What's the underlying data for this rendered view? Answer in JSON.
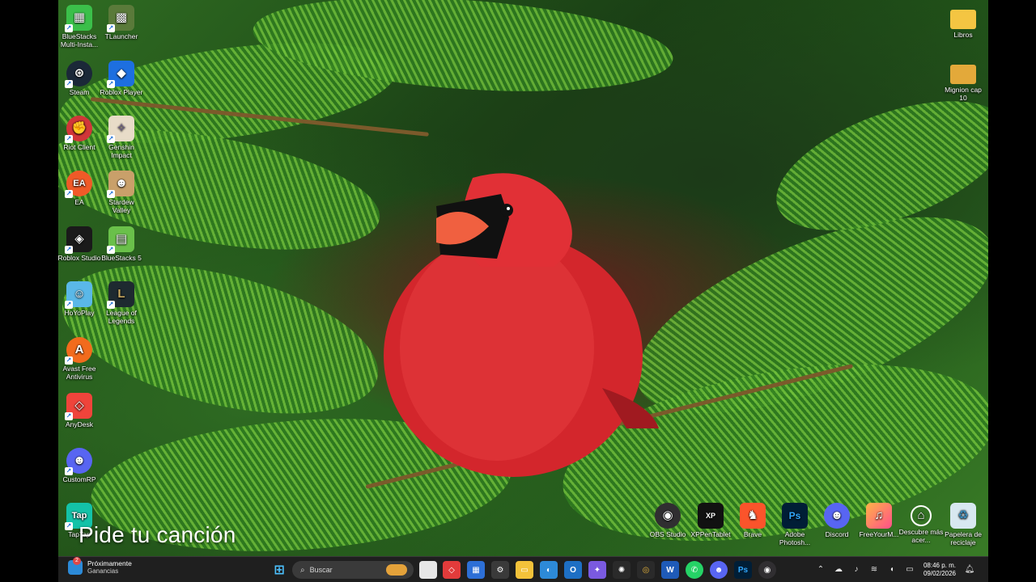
{
  "desktop": {
    "left_icons": [
      {
        "label": "BlueStacks Multi-Insta...",
        "icon": "bluestacks-multi-icon",
        "color": "#3bbf4a"
      },
      {
        "label": "TLauncher",
        "icon": "tlauncher-icon",
        "color": "#5a7a3a"
      },
      {
        "label": "Steam",
        "icon": "steam-icon",
        "color": "#1b2838"
      },
      {
        "label": "Roblox Player",
        "icon": "roblox-player-icon",
        "color": "#1d6fe0"
      },
      {
        "label": "Riot Client",
        "icon": "riot-client-icon",
        "color": "#d13639"
      },
      {
        "label": "Genshin Impact",
        "icon": "genshin-impact-icon",
        "color": "#e8dcc8"
      },
      {
        "label": "EA",
        "icon": "ea-icon",
        "color": "#f05a28"
      },
      {
        "label": "Stardew Valley",
        "icon": "stardew-valley-icon",
        "color": "#c9a06a"
      },
      {
        "label": "Roblox Studio",
        "icon": "roblox-studio-icon",
        "color": "#1a1a1a"
      },
      {
        "label": "BlueStacks 5",
        "icon": "bluestacks5-icon",
        "color": "#6ac04a"
      },
      {
        "label": "HoYoPlay",
        "icon": "hoyoplay-icon",
        "color": "#5ab8e8"
      },
      {
        "label": "League of Legends",
        "icon": "league-of-legends-icon",
        "color": "#1e2a30"
      },
      {
        "label": "Avast Free Antivirus",
        "icon": "avast-icon",
        "color": "#f26b1d"
      },
      {
        "label": "AnyDesk",
        "icon": "anydesk-icon",
        "color": "#ef443b"
      },
      {
        "label": "CustomRP",
        "icon": "customrp-icon",
        "color": "#5865f2"
      },
      {
        "label": "TapTap",
        "icon": "taptap-icon",
        "color": "#14c2a8"
      }
    ],
    "right_top_icons": [
      {
        "label": "Libros",
        "icon": "folder-icon",
        "color": "#f4c542"
      },
      {
        "label": "Mignion cap 10",
        "icon": "folder-image-icon",
        "color": "#e3a93a"
      }
    ],
    "bottom_icons": [
      {
        "label": "OBS Studio",
        "icon": "obs-studio-icon",
        "color": "#302e31"
      },
      {
        "label": "XPPenTablet",
        "icon": "xppen-icon",
        "color": "#111111"
      },
      {
        "label": "Brave",
        "icon": "brave-icon",
        "color": "#fb542b"
      },
      {
        "label": "Adobe Photosh...",
        "icon": "photoshop-icon",
        "color": "#001e36"
      },
      {
        "label": "Discord",
        "icon": "discord-icon",
        "color": "#5865f2"
      },
      {
        "label": "FreeYourM...",
        "icon": "freeyourmusic-icon",
        "color": "#ff4f8a"
      },
      {
        "label": "Descubre más acer...",
        "icon": "acer-discover-icon",
        "color": "#2a2a2a"
      },
      {
        "label": "Papelera de reciclaje",
        "icon": "recycle-bin-icon",
        "color": "#d8e8f0"
      }
    ],
    "overlay_text": "Pide tu canción"
  },
  "taskbar": {
    "weather_title": "Próximamente",
    "weather_subtitle": "Ganancias",
    "weather_badge": "2",
    "search_placeholder": "Buscar",
    "time": "08:46 p. m.",
    "date": "09/02/2026"
  }
}
